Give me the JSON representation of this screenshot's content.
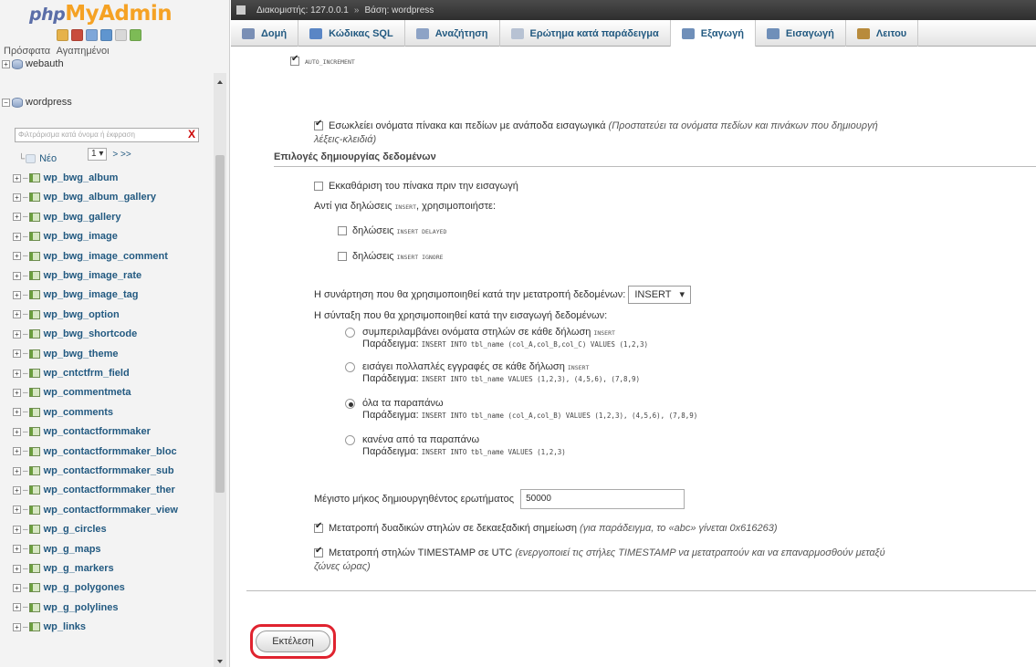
{
  "nav": {
    "logo_php": "php",
    "logo_myadmin": "MyAdmin",
    "recent_label": "Πρόσφατα",
    "favorites_label": "Αγαπημένοι",
    "databases": [
      {
        "name": "webauth",
        "expanded": false
      },
      {
        "name": "wordpress",
        "expanded": true
      }
    ],
    "filter_placeholder": "Φιλτράρισμα κατά όνομα ή έκφραση",
    "filter_clear": "X",
    "page_value": "1",
    "page_nav": "> >>",
    "new_label": "Νέο",
    "tables": [
      "wp_bwg_album",
      "wp_bwg_album_gallery",
      "wp_bwg_gallery",
      "wp_bwg_image",
      "wp_bwg_image_comment",
      "wp_bwg_image_rate",
      "wp_bwg_image_tag",
      "wp_bwg_option",
      "wp_bwg_shortcode",
      "wp_bwg_theme",
      "wp_cntctfrm_field",
      "wp_commentmeta",
      "wp_comments",
      "wp_contactformmaker",
      "wp_contactformmaker_bloc",
      "wp_contactformmaker_sub",
      "wp_contactformmaker_ther",
      "wp_contactformmaker_view",
      "wp_g_circles",
      "wp_g_maps",
      "wp_g_markers",
      "wp_g_polygones",
      "wp_g_polylines",
      "wp_links"
    ]
  },
  "breadcrumb": {
    "server": "Διακομιστής: 127.0.0.1",
    "separator": "»",
    "database": "Βάση: wordpress"
  },
  "tabs": [
    {
      "label": "Δομή",
      "icon": "structure-icon",
      "color": "#7a8fb5"
    },
    {
      "label": "Κώδικας SQL",
      "icon": "sql-icon",
      "color": "#5a86c5"
    },
    {
      "label": "Αναζήτηση",
      "icon": "search-icon",
      "color": "#8da3c6"
    },
    {
      "label": "Ερώτημα κατά παράδειγμα",
      "icon": "query-icon",
      "color": "#b7c2d3"
    },
    {
      "label": "Εξαγωγή",
      "icon": "export-icon",
      "color": "#6f8fb9"
    },
    {
      "label": "Εισαγωγή",
      "icon": "import-icon",
      "color": "#6f8fb9"
    },
    {
      "label": "Λειτου",
      "icon": "operations-icon",
      "color": "#b88b3c"
    }
  ],
  "content": {
    "auto_increment_label": "AUTO_INCREMENT",
    "backquotes_label": "Εσωκλείει ονόματα πίνακα και πεδίων με ανάποδα εισαγωγικά",
    "backquotes_note": "(Προστατεύει τα ονόματα πεδίων και πινάκων που δημιουργή",
    "backquotes_note2": "λέξεις-κλειδιά)",
    "data_section_title": "Επιλογές δημιουργίας δεδομένων",
    "truncate_label": "Εκκαθάριση του πίνακα πριν την εισαγωγή",
    "instead_insert_label": "Αντί για δηλώσεις",
    "instead_insert_kw": "INSERT",
    "instead_insert_suffix": ", χρησιμοποιήστε:",
    "delayed_label": "δηλώσεις",
    "delayed_kw": "INSERT DELAYED",
    "ignore_label": "δηλώσεις",
    "ignore_kw": "INSERT IGNORE",
    "function_label": "Η συνάρτηση που θα χρησιμοποιηθεί κατά την μετατροπή δεδομένων:",
    "function_value": "INSERT",
    "syntax_label": "Η σύνταξη που θα χρησιμοποιηθεί κατά την εισαγωγή δεδομένων:",
    "syntax_options": [
      {
        "title": "συμπεριλαμβάνει ονόματα στηλών σε κάθε δήλωση",
        "kw": "INSERT",
        "example_label": "Παράδειγμα:",
        "example": "INSERT INTO tbl_name (col_A,col_B,col_C) VALUES (1,2,3)",
        "checked": false
      },
      {
        "title": "εισάγει πολλαπλές εγγραφές σε κάθε δήλωση",
        "kw": "INSERT",
        "example_label": "Παράδειγμα:",
        "example": "INSERT INTO tbl_name VALUES (1,2,3), (4,5,6), (7,8,9)",
        "checked": false
      },
      {
        "title": "όλα τα παραπάνω",
        "kw": "",
        "example_label": "Παράδειγμα:",
        "example": "INSERT INTO tbl_name (col_A,col_B) VALUES (1,2,3), (4,5,6), (7,8,9)",
        "checked": true
      },
      {
        "title": "κανένα από τα παραπάνω",
        "kw": "",
        "example_label": "Παράδειγμα:",
        "example": "INSERT INTO tbl_name VALUES (1,2,3)",
        "checked": false
      }
    ],
    "max_length_label": "Μέγιστο μήκος δημιουργηθέντος ερωτήματος",
    "max_length_value": "50000",
    "hex_label": "Μετατροπή δυαδικών στηλών σε δεκαεξαδική σημείωση",
    "hex_note": "(για παράδειγμα, το «abc» γίνεται 0x616263)",
    "utc_label": "Μετατροπή στηλών TIMESTAMP σε UTC",
    "utc_note": "(ενεργοποιεί τις στήλες TIMESTAMP να μετατραπούν και να επαναρμοσθούν μεταξύ",
    "utc_note2": "ζώνες ώρας)",
    "go_button": "Εκτέλεση"
  },
  "colors": {
    "highlight": "#e0232f",
    "link": "#235a81",
    "logo_accent": "#f5a224"
  }
}
